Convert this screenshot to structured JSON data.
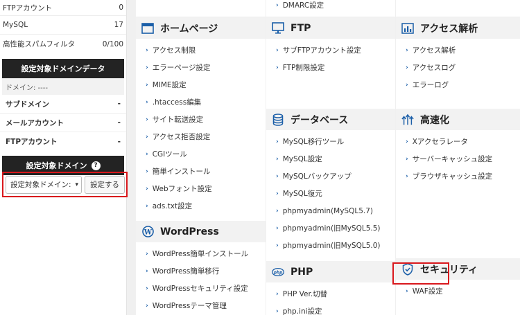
{
  "sidebar": {
    "stats": [
      {
        "label": "FTPアカウント",
        "value": "0"
      },
      {
        "label": "MySQL",
        "value": "17"
      },
      {
        "label": "高性能スパムフィルタ",
        "value": "0/100"
      }
    ],
    "domain_data_header": "設定対象ドメインデータ",
    "domain_line": "ドメイン: ----",
    "domain_stats": [
      {
        "label": "サブドメイン",
        "value": "-"
      },
      {
        "label": "メールアカウント",
        "value": "-"
      },
      {
        "label": "FTPアカウント",
        "value": "-"
      }
    ],
    "target_domain_header": "設定対象ドメイン",
    "help_icon": "?",
    "select_value": "設定対象ドメイン:",
    "set_button": "設定する"
  },
  "top_partial": {
    "dmarc": "DMARC設定"
  },
  "sections": {
    "homepage": {
      "title": "ホームページ",
      "items": [
        "アクセス制限",
        "エラーページ設定",
        "MIME設定",
        ".htaccess編集",
        "サイト転送設定",
        "アクセス拒否設定",
        "CGIツール",
        "簡単インストール",
        "Webフォント設定",
        "ads.txt設定"
      ]
    },
    "wordpress": {
      "title": "WordPress",
      "items": [
        "WordPress簡単インストール",
        "WordPress簡単移行",
        "WordPressセキュリティ設定",
        "WordPressテーマ管理"
      ]
    },
    "ftp": {
      "title": "FTP",
      "items": [
        "サブFTPアカウント設定",
        "FTP制限設定"
      ]
    },
    "database": {
      "title": "データベース",
      "items": [
        "MySQL移行ツール",
        "MySQL設定",
        "MySQLバックアップ",
        "MySQL復元",
        "phpmyadmin(MySQL5.7)",
        "phpmyadmin(旧MySQL5.5)",
        "phpmyadmin(旧MySQL5.0)"
      ]
    },
    "php": {
      "title": "PHP",
      "items": [
        "PHP Ver.切替",
        "php.ini設定"
      ]
    },
    "access": {
      "title": "アクセス解析",
      "items": [
        "アクセス解析",
        "アクセスログ",
        "エラーログ"
      ]
    },
    "speed": {
      "title": "高速化",
      "items": [
        "Xアクセラレータ",
        "サーバーキャッシュ設定",
        "ブラウザキャッシュ設定"
      ]
    },
    "security": {
      "title": "セキュリティ",
      "items": [
        "WAF設定"
      ]
    }
  },
  "colors": {
    "accent": "#1a5ea8",
    "highlight": "#d9171c",
    "dark": "#232323"
  },
  "icons": {
    "homepage": "browser-window-icon",
    "ftp": "monitor-icon",
    "access": "bar-chart-icon",
    "database": "database-icon",
    "speed": "speed-arrows-icon",
    "wordpress": "wordpress-logo-icon",
    "php": "php-badge-icon",
    "security": "shield-check-icon"
  }
}
